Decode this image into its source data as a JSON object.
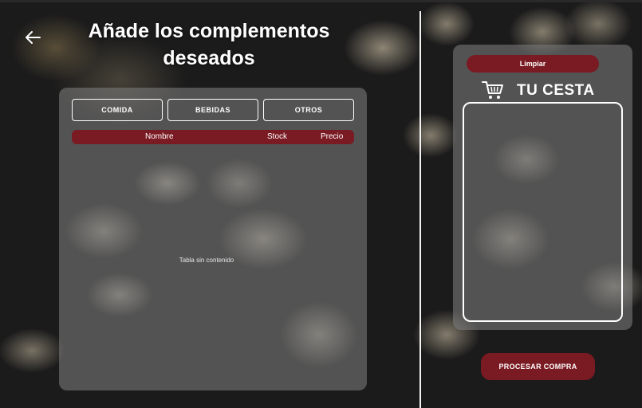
{
  "header": {
    "title": "Añade los complementos deseados",
    "back_icon": "arrow-left-icon"
  },
  "categories": [
    {
      "label": "COMIDA"
    },
    {
      "label": "BEBIDAS"
    },
    {
      "label": "OTROS"
    }
  ],
  "table": {
    "columns": [
      "Nombre",
      "Stock",
      "Precio"
    ],
    "rows": [],
    "empty_message": "Tabla sin contenido"
  },
  "basket": {
    "clear_label": "Limpiar",
    "title": "TU CESTA",
    "icon": "shopping-cart-icon",
    "items": []
  },
  "checkout": {
    "label": "PROCESAR COMPRA"
  },
  "colors": {
    "accent": "#7a1a22",
    "panel": "#828282",
    "text": "#ffffff"
  }
}
